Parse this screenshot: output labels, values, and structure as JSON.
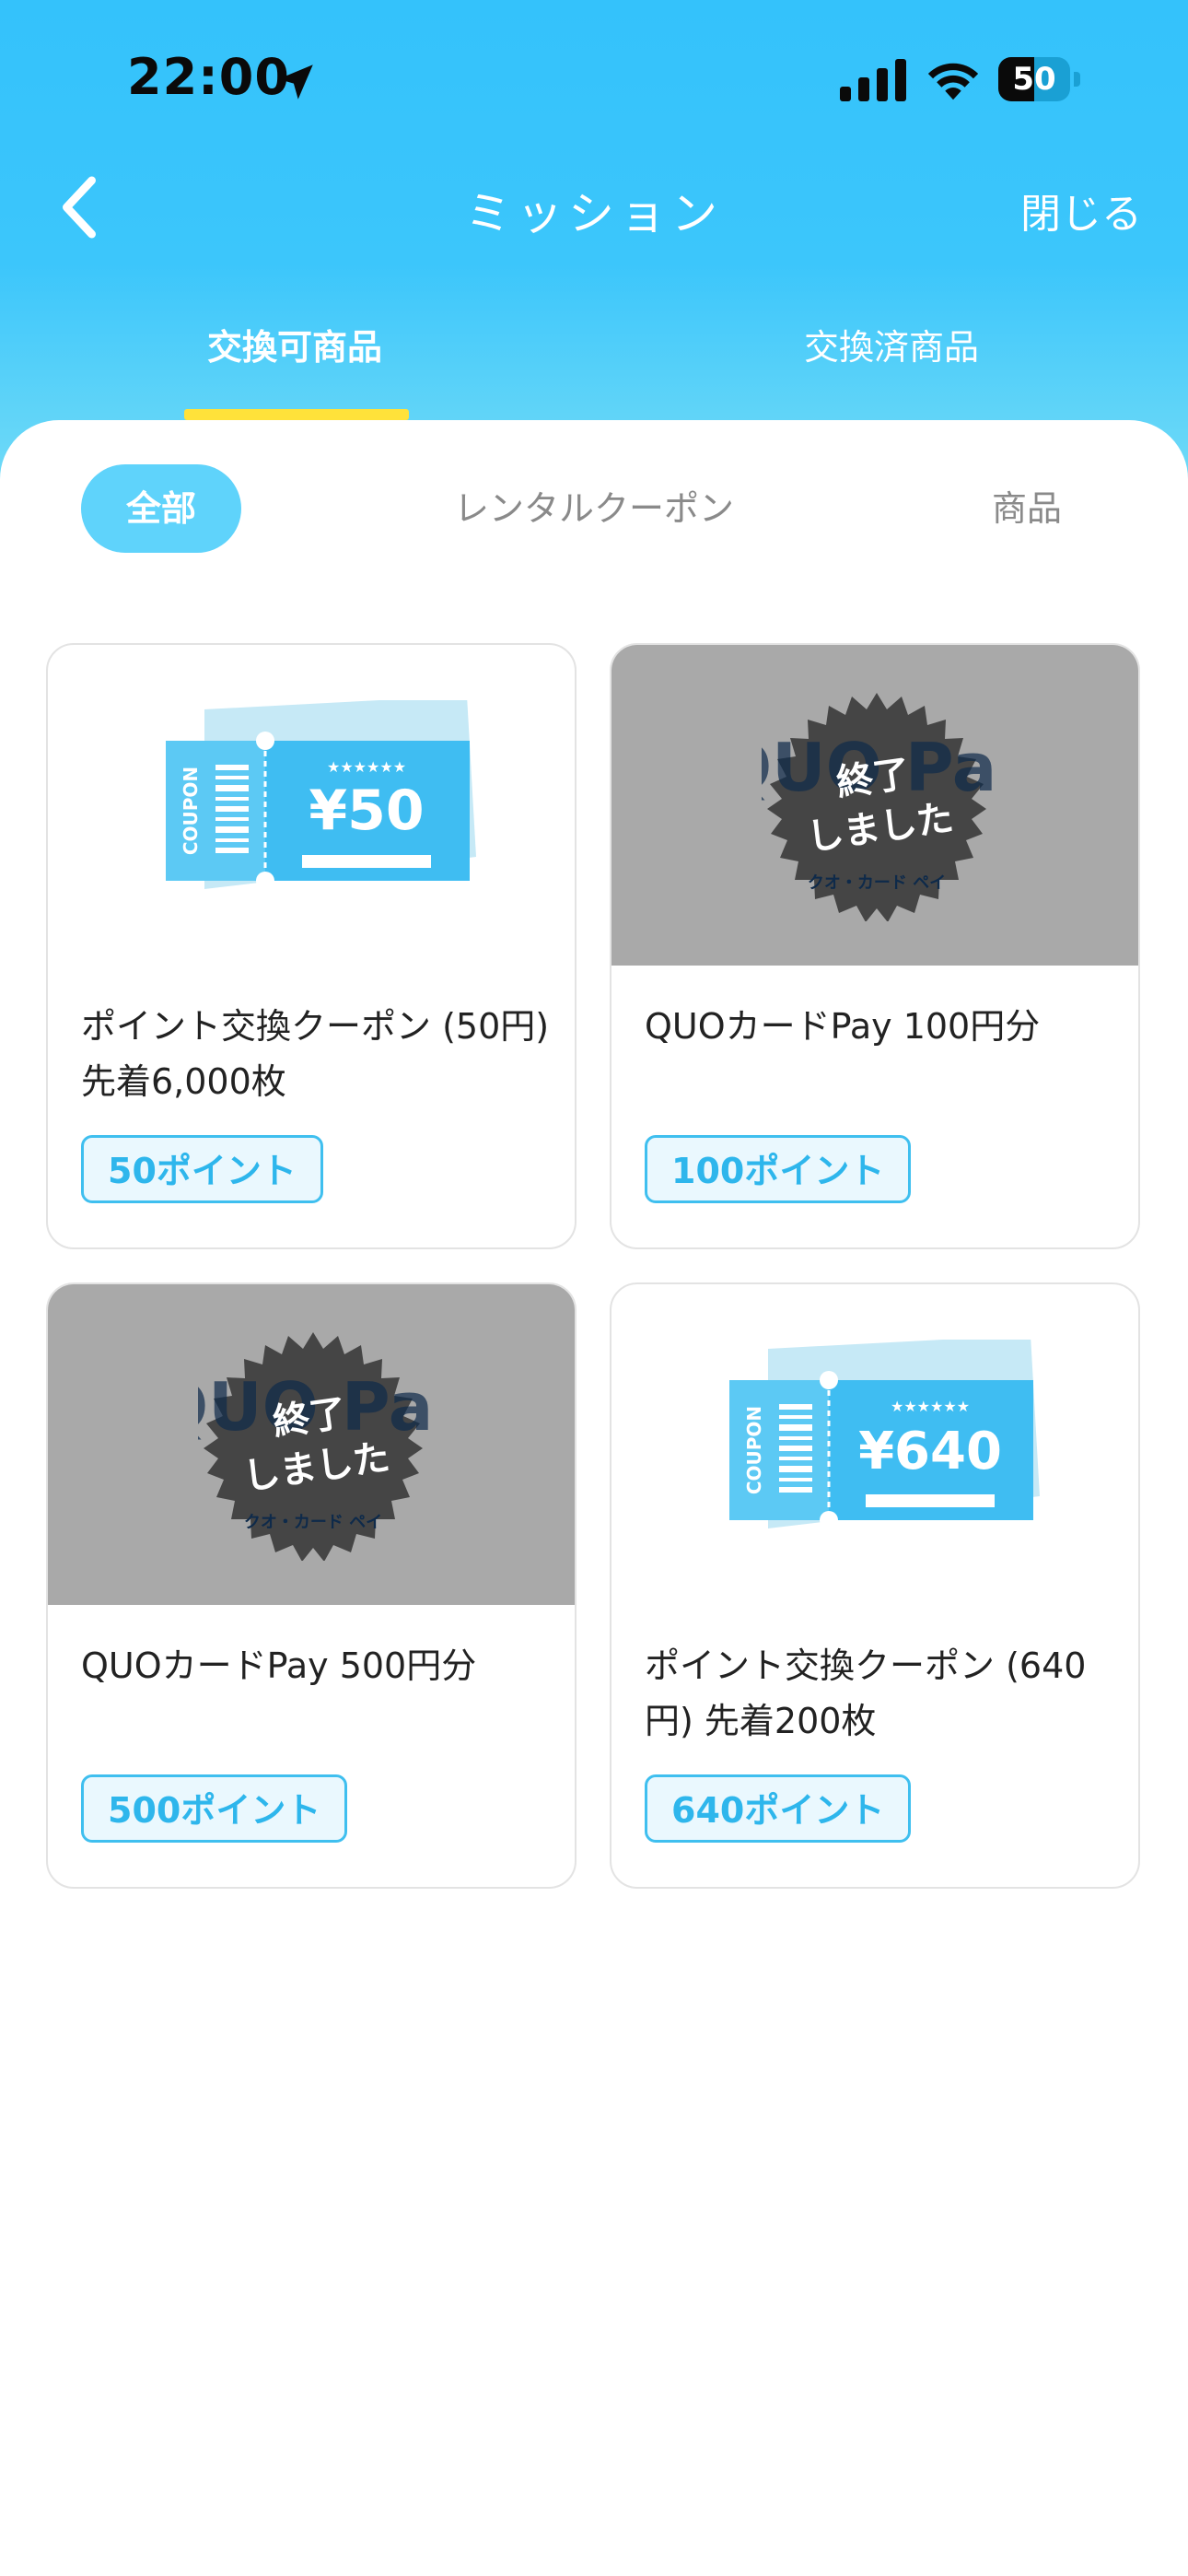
{
  "status_bar": {
    "time": "22:00",
    "battery": "50"
  },
  "nav": {
    "title": "ミッション",
    "close_label": "閉じる"
  },
  "tabs": [
    {
      "label": "交換可商品",
      "active": true
    },
    {
      "label": "交換済商品",
      "active": false
    }
  ],
  "filters": [
    {
      "label": "全部",
      "active": true
    },
    {
      "label": "レンタルクーポン",
      "active": false
    },
    {
      "label": "商品",
      "active": false
    }
  ],
  "products": [
    {
      "title": "ポイント交換クーポン (50円) 先着6,000枚",
      "price": "50ポイント",
      "image": "coupon-ticket",
      "coupon_value": "¥50",
      "coupon_side": "COUPON",
      "stars": "★★★★★★",
      "ended": false
    },
    {
      "title": "QUOカードPay 100円分",
      "price": "100ポイント",
      "image": "quo-card",
      "brand": "QUO Pay",
      "brand_sub": "クオ・カード ペイ",
      "ended_label": "終了しました",
      "ended": true
    },
    {
      "title": "QUOカードPay 500円分",
      "price": "500ポイント",
      "image": "quo-card",
      "brand": "QUO Pay",
      "brand_sub": "クオ・カード ペイ",
      "ended_label": "終了しました",
      "ended": true
    },
    {
      "title": "ポイント交換クーポン (640円) 先着200枚",
      "price": "640ポイント",
      "image": "coupon-ticket",
      "coupon_value": "¥640",
      "coupon_side": "COUPON",
      "stars": "★★★★★★",
      "ended": false
    }
  ],
  "colors": {
    "header": "#34c2fb",
    "accent": "#2eb6ec",
    "indicator": "#ffe23a",
    "ended_overlay": "#a9a9a9"
  }
}
